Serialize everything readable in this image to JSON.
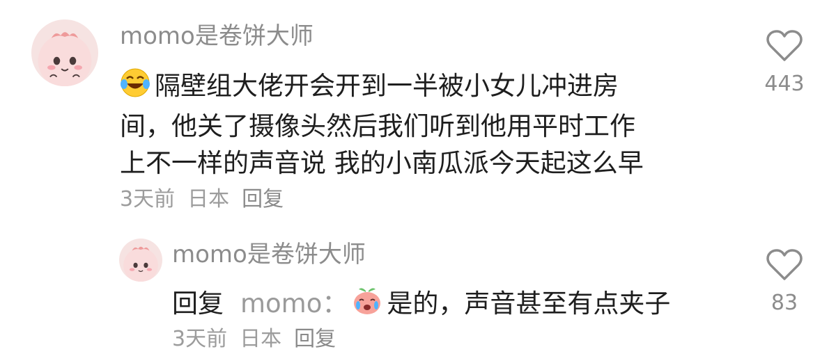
{
  "comments": [
    {
      "username": "momo是卷饼大师",
      "emoji": "laughing-tears-emoji",
      "lines": [
        "隔壁组大佬开会开到一半被小女儿冲进房",
        "间，他关了摄像头然后我们听到他用平时工作",
        "上不一样的声音说 我的小南瓜派今天起这么早"
      ],
      "time": "3天前",
      "location": "日本",
      "reply_label": "回复",
      "like_count": "443"
    }
  ],
  "reply": {
    "username": "momo是卷饼大师",
    "prefix": "回复",
    "mention": "momo：",
    "emoji": "crying-peach-emoji",
    "text": "是的，声音甚至有点夹子",
    "time": "3天前",
    "location": "日本",
    "reply_label": "回复",
    "like_count": "83"
  },
  "colors": {
    "username": "#8c8c8c",
    "meta": "#9c9c9c",
    "text": "#1e1e1e",
    "avatar_bg": "#f7dede"
  }
}
